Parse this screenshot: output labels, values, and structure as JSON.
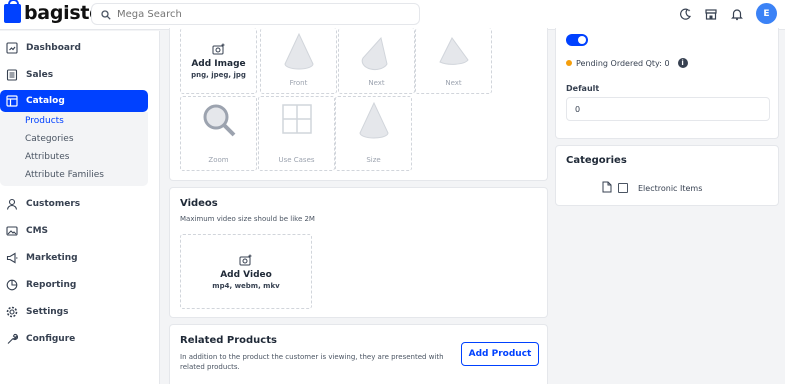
{
  "app": {
    "brand": "bagisto"
  },
  "search": {
    "placeholder": "Mega Search"
  },
  "user": {
    "initial": "E"
  },
  "sidebar": {
    "items": [
      {
        "label": "Dashboard",
        "icon": "dashboard-icon"
      },
      {
        "label": "Sales",
        "icon": "sales-icon"
      },
      {
        "label": "Catalog",
        "icon": "catalog-icon"
      },
      {
        "label": "Customers",
        "icon": "customers-icon"
      },
      {
        "label": "CMS",
        "icon": "cms-icon"
      },
      {
        "label": "Marketing",
        "icon": "marketing-icon"
      },
      {
        "label": "Reporting",
        "icon": "reporting-icon"
      },
      {
        "label": "Settings",
        "icon": "settings-icon"
      },
      {
        "label": "Configure",
        "icon": "configure-icon"
      }
    ],
    "catalog_sub": [
      "Products",
      "Categories",
      "Attributes",
      "Attribute Families"
    ]
  },
  "images": {
    "upload_title": "Add Image",
    "upload_formats": "png, jpeg, jpg",
    "tiles": [
      "Front",
      "Next",
      "Next",
      "Zoom",
      "Use Cases",
      "Size"
    ]
  },
  "videos": {
    "title": "Videos",
    "subtitle": "Maximum video size should be like 2M",
    "upload_title": "Add Video",
    "upload_formats": "mp4, webm, mkv"
  },
  "related": {
    "title": "Related Products",
    "subtitle_line1": "In addition to the product the customer is viewing, they are presented with",
    "subtitle_line2": "related products.",
    "button": "Add Product"
  },
  "inventory": {
    "pending_label": "Pending Ordered Qty: 0",
    "default_label": "Default",
    "default_value": "0"
  },
  "categories": {
    "title": "Categories",
    "items": [
      "Electronic Items"
    ]
  },
  "colors": {
    "primary": "#0041ff",
    "pending_dot": "#f59e0b"
  }
}
